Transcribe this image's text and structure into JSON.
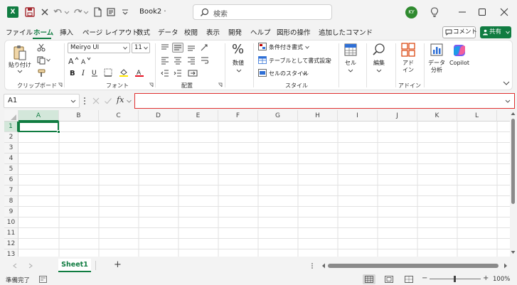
{
  "window": {
    "doc_title": "Book2 ·",
    "search_placeholder": "検索",
    "avatar_initials": "KY"
  },
  "menu": {
    "tabs": [
      "ファイル",
      "ホーム",
      "挿入",
      "ページ レイアウト",
      "数式",
      "データ",
      "校閲",
      "表示",
      "開発",
      "ヘルプ",
      "図形の操作",
      "追加したコマンド"
    ],
    "active_tab": "ホーム",
    "comment_label": "コメント",
    "share_label": "共有"
  },
  "ribbon": {
    "clipboard": {
      "paste_label": "貼り付け",
      "group_label": "クリップボード"
    },
    "font": {
      "font_name": "Meiryo UI",
      "font_size": "11",
      "group_label": "フォント"
    },
    "alignment": {
      "group_label": "配置"
    },
    "number": {
      "label": "数値",
      "number_icon_text": "%"
    },
    "styles": {
      "conditional_format": "条件付き書式",
      "table_format": "テーブルとして書式設定",
      "cell_styles": "セルのスタイル",
      "group_label": "スタイル"
    },
    "cells": {
      "label": "セル"
    },
    "editing": {
      "label": "編集"
    },
    "addins": {
      "label_line1": "アド",
      "label_line2": "イン",
      "group_label": "アドイン"
    },
    "data_analysis": {
      "label_line1": "データ",
      "label_line2": "分析"
    },
    "copilot": {
      "label": "Copilot"
    },
    "colors": {
      "accent": "#107c41"
    }
  },
  "formula_bar": {
    "name_box": "A1",
    "fx_label": "fx",
    "formula_value": ""
  },
  "grid": {
    "columns": [
      "A",
      "B",
      "C",
      "D",
      "E",
      "F",
      "G",
      "H",
      "I",
      "J",
      "K",
      "L"
    ],
    "rows": [
      "1",
      "2",
      "3",
      "4",
      "5",
      "6",
      "7",
      "8",
      "9",
      "10",
      "11",
      "12",
      "13"
    ],
    "active_cell": "A1"
  },
  "sheets": {
    "tabs": [
      "Sheet1"
    ],
    "add_label": "+"
  },
  "status": {
    "ready_text": "準備完了",
    "zoom": "100%"
  }
}
